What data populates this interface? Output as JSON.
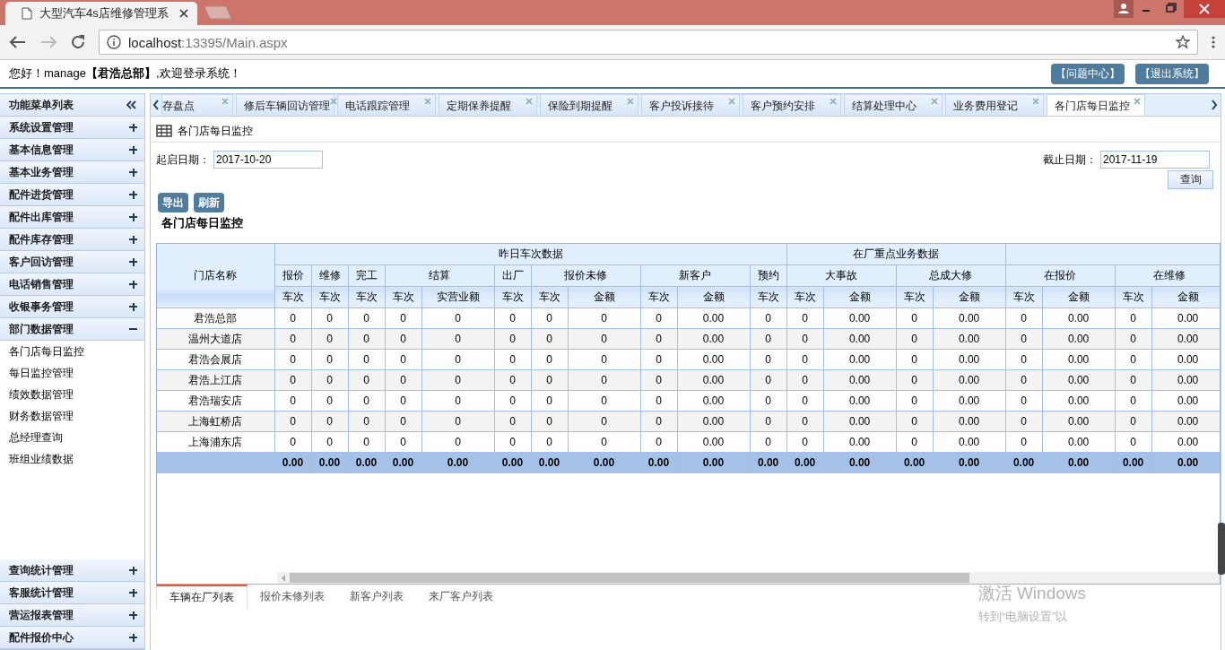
{
  "browser": {
    "tab_title": "大型汽车4s店维修管理系",
    "url_host": "localhost",
    "url_path": ":13395/Main.aspx"
  },
  "header": {
    "greeting": "您好！manage**【君浩总部】**,欢迎登录系统！",
    "buttons": [
      "【问题中心】",
      "【退出系统】"
    ]
  },
  "sidebar": {
    "title": "功能菜单列表",
    "items": [
      {
        "label": "系统设置管理",
        "expanded": false
      },
      {
        "label": "基本信息管理",
        "expanded": false
      },
      {
        "label": "基本业务管理",
        "expanded": false
      },
      {
        "label": "配件进货管理",
        "expanded": false
      },
      {
        "label": "配件出库管理",
        "expanded": false
      },
      {
        "label": "配件库存管理",
        "expanded": false
      },
      {
        "label": "客户回访管理",
        "expanded": false
      },
      {
        "label": "电话销售管理",
        "expanded": false
      },
      {
        "label": "收银事务管理",
        "expanded": false
      },
      {
        "label": "部门数据管理",
        "expanded": true,
        "children": [
          "各门店每日监控",
          "每日监控管理",
          "绩效数据管理",
          "财务数据管理",
          "总经理查询",
          "班组业绩数据"
        ]
      }
    ],
    "bottom_items": [
      {
        "label": "查询统计管理",
        "expanded": false
      },
      {
        "label": "客服统计管理",
        "expanded": false
      },
      {
        "label": "营运报表管理",
        "expanded": false
      },
      {
        "label": "配件报价中心",
        "expanded": false
      }
    ]
  },
  "tabs": [
    {
      "label": "存盘点",
      "selected": false
    },
    {
      "label": "修后车辆回访管理",
      "selected": false
    },
    {
      "label": "电话跟踪管理",
      "selected": false
    },
    {
      "label": "定期保养提醒",
      "selected": false
    },
    {
      "label": "保险到期提醒",
      "selected": false
    },
    {
      "label": "客户投诉接待",
      "selected": false
    },
    {
      "label": "客户预约安排",
      "selected": false
    },
    {
      "label": "结算处理中心",
      "selected": false
    },
    {
      "label": "业务费用登记",
      "selected": false
    },
    {
      "label": "各门店每日监控",
      "selected": true
    }
  ],
  "panel": {
    "title": "各门店每日监控",
    "start_date": {
      "label": "起启日期：",
      "value": "2017-10-20"
    },
    "end_date": {
      "label": "截止日期：",
      "value": "2017-11-19"
    },
    "query_button": "查询",
    "actions": [
      "导出",
      "刷新"
    ],
    "heading": "各门店每日监控",
    "table": {
      "name_column": "门店名称",
      "groups": [
        {
          "label": "昨日车次数据",
          "columns": [
            {
              "label": "报价",
              "sub": [
                "车次"
              ]
            },
            {
              "label": "维修",
              "sub": [
                "车次"
              ]
            },
            {
              "label": "完工",
              "sub": [
                "车次"
              ]
            },
            {
              "label": "结算",
              "sub": [
                "车次",
                "实营业额"
              ]
            },
            {
              "label": "出厂",
              "sub": [
                "车次"
              ]
            },
            {
              "label": "报价未修",
              "sub": [
                "车次",
                "金额"
              ]
            },
            {
              "label": "新客户",
              "sub": [
                "车次",
                "金额"
              ]
            },
            {
              "label": "预约",
              "sub": [
                "车次"
              ]
            }
          ]
        },
        {
          "label": "在厂重点业务数据",
          "columns": [
            {
              "label": "大事故",
              "sub": [
                "车次",
                "金额"
              ]
            },
            {
              "label": "总成大修",
              "sub": [
                "车次",
                "金额"
              ]
            }
          ]
        },
        {
          "columns": [
            {
              "label": "在报价",
              "sub": [
                "车次",
                "金额"
              ]
            },
            {
              "label": "在维修",
              "sub": [
                "车次",
                "金额"
              ]
            }
          ]
        }
      ],
      "rows": [
        {
          "name": "君浩总部",
          "cells": [
            "0",
            "0",
            "0",
            "0",
            "0",
            "0",
            "0",
            "0",
            "0",
            "0.00",
            "0",
            "0",
            "0.00",
            "0",
            "0.00",
            "0",
            "0.00",
            "0",
            "0.00"
          ]
        },
        {
          "name": "温州大道店",
          "cells": [
            "0",
            "0",
            "0",
            "0",
            "0",
            "0",
            "0",
            "0",
            "0",
            "0.00",
            "0",
            "0",
            "0.00",
            "0",
            "0.00",
            "0",
            "0.00",
            "0",
            "0.00"
          ]
        },
        {
          "name": "君浩会展店",
          "cells": [
            "0",
            "0",
            "0",
            "0",
            "0",
            "0",
            "0",
            "0",
            "0",
            "0.00",
            "0",
            "0",
            "0.00",
            "0",
            "0.00",
            "0",
            "0.00",
            "0",
            "0.00"
          ]
        },
        {
          "name": "君浩上江店",
          "cells": [
            "0",
            "0",
            "0",
            "0",
            "0",
            "0",
            "0",
            "0",
            "0",
            "0.00",
            "0",
            "0",
            "0.00",
            "0",
            "0.00",
            "0",
            "0.00",
            "0",
            "0.00"
          ]
        },
        {
          "name": "君浩瑞安店",
          "cells": [
            "0",
            "0",
            "0",
            "0",
            "0",
            "0",
            "0",
            "0",
            "0",
            "0.00",
            "0",
            "0",
            "0.00",
            "0",
            "0.00",
            "0",
            "0.00",
            "0",
            "0.00"
          ]
        },
        {
          "name": "上海虹桥店",
          "cells": [
            "0",
            "0",
            "0",
            "0",
            "0",
            "0",
            "0",
            "0",
            "0",
            "0.00",
            "0",
            "0",
            "0.00",
            "0",
            "0.00",
            "0",
            "0.00",
            "0",
            "0.00"
          ]
        },
        {
          "name": "上海浦东店",
          "cells": [
            "0",
            "0",
            "0",
            "0",
            "0",
            "0",
            "0",
            "0",
            "0",
            "0.00",
            "0",
            "0",
            "0.00",
            "0",
            "0.00",
            "0",
            "0.00",
            "0",
            "0.00"
          ]
        }
      ],
      "totals": [
        "0.00",
        "0.00",
        "0.00",
        "0.00",
        "0.00",
        "0.00",
        "0.00",
        "0.00",
        "0.00",
        "0.00",
        "0.00",
        "0.00",
        "0.00",
        "0.00",
        "0.00",
        "0.00",
        "0.00",
        "0.00",
        "0.00"
      ]
    },
    "bottom_tabs": [
      {
        "label": "车辆在厂列表",
        "selected": true
      },
      {
        "label": "报价未修列表",
        "selected": false
      },
      {
        "label": "新客户列表",
        "selected": false
      },
      {
        "label": "来厂客户列表",
        "selected": false
      }
    ]
  },
  "os_notice": [
    "激活 Windows",
    "转到“电脑设置”以"
  ]
}
